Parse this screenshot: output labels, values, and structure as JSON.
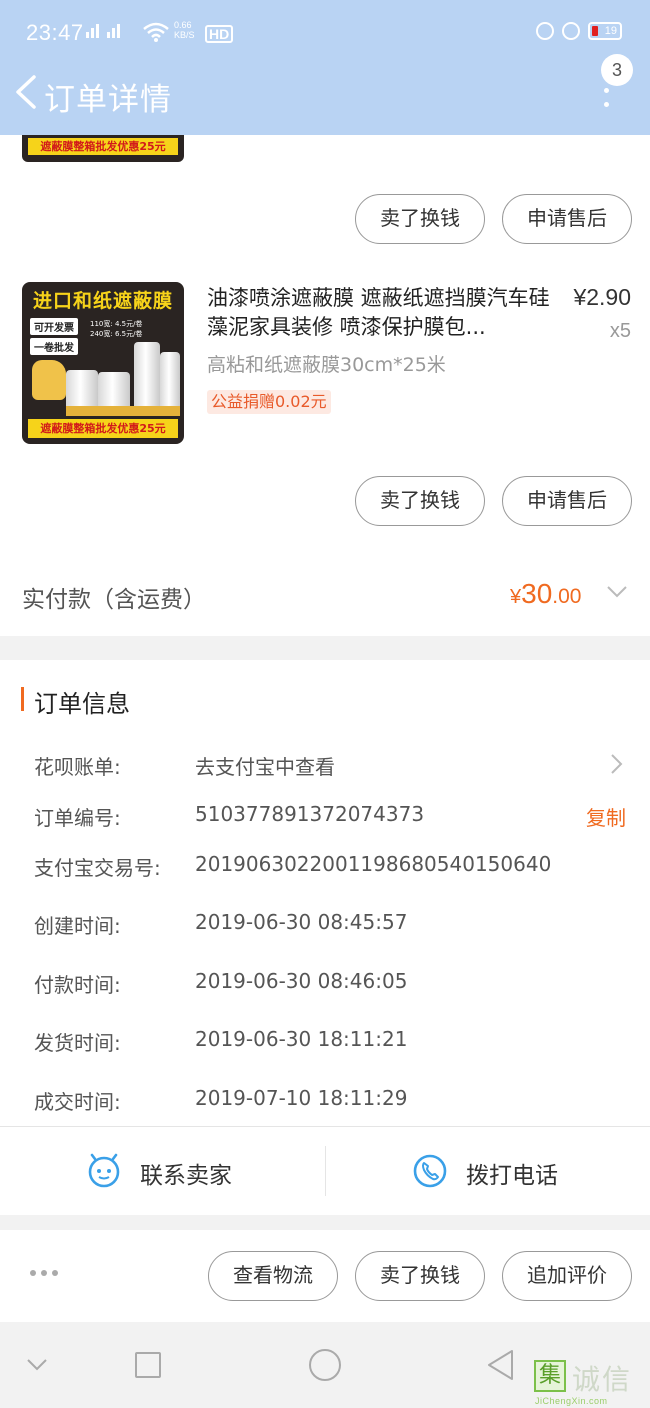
{
  "status_bar": {
    "time": "23:47",
    "net_speed_top": "0.66",
    "net_speed_bottom": "KB/S",
    "hd": "HD",
    "battery": "19"
  },
  "header": {
    "title": "订单详情",
    "badge_count": "3"
  },
  "prev_item": {
    "band_text": "遮蔽膜整箱批发优惠25元",
    "buttons": [
      "卖了换钱",
      "申请售后"
    ]
  },
  "item": {
    "image": {
      "headline": "进口和纸遮蔽膜",
      "tag1": "可开发票",
      "tag2": "一卷批发",
      "price1": "110宽: 4.5元/卷",
      "price2": "240宽: 6.5元/卷",
      "band_text": "遮蔽膜整箱批发优惠25元"
    },
    "title": "油漆喷涂遮蔽膜 遮蔽纸遮挡膜汽车硅藻泥家具装修 喷漆保护膜包...",
    "price": "¥2.90",
    "qty": "x5",
    "sku": "高粘和纸遮蔽膜30cm*25米",
    "donation": "公益捐赠0.02元",
    "buttons": [
      "卖了换钱",
      "申请售后"
    ]
  },
  "payment": {
    "label": "实付款（含运费）",
    "currency": "¥",
    "amount_int": "30",
    "amount_dec": ".00"
  },
  "order_info": {
    "title": "订单信息",
    "rows": [
      {
        "label": "花呗账单:",
        "value": "去支付宝中查看"
      },
      {
        "label": "订单编号:",
        "value": "510377891372074373"
      },
      {
        "label": "支付宝交易号:",
        "value": "2019063022001198680540150640"
      },
      {
        "label": "创建时间:",
        "value": "2019-06-30 08:45:57"
      },
      {
        "label": "付款时间:",
        "value": "2019-06-30 08:46:05"
      },
      {
        "label": "发货时间:",
        "value": "2019-06-30 18:11:21"
      },
      {
        "label": "成交时间:",
        "value": "2019-07-10 18:11:29"
      }
    ],
    "copy_label": "复制"
  },
  "contact": {
    "seller_label": "联系卖家",
    "call_label": "拨打电话"
  },
  "bottom_actions": [
    "查看物流",
    "卖了换钱",
    "追加评价"
  ],
  "watermark": {
    "box_char": "集",
    "text": "诚信",
    "url": "JiChengXin.com"
  },
  "colors": {
    "header_bg": "#b9d3f3",
    "accent": "#f06a20",
    "page_bg": "#f2f2f2"
  }
}
